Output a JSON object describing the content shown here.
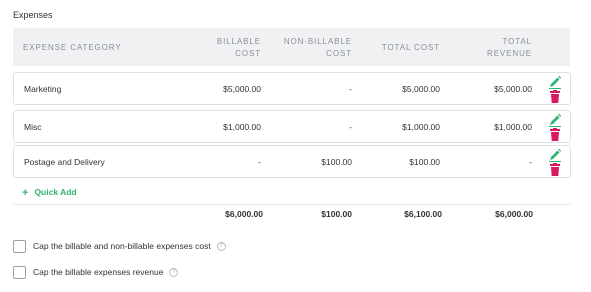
{
  "section_title": "Expenses",
  "columns": {
    "category": "EXPENSE CATEGORY",
    "billable_line1": "BILLABLE",
    "billable_line2": "COST",
    "nonbillable_line1": "NON-BILLABLE",
    "nonbillable_line2": "COST",
    "total_cost": "TOTAL COST",
    "total_revenue_line1": "TOTAL",
    "total_revenue_line2": "REVENUE"
  },
  "rows": [
    {
      "category": "Marketing",
      "billable": "$5,000.00",
      "nonbillable": "-",
      "total_cost": "$5,000.00",
      "total_revenue": "$5,000.00"
    },
    {
      "category": "Misc",
      "billable": "$1,000.00",
      "nonbillable": "-",
      "total_cost": "$1,000.00",
      "total_revenue": "$1,000.00"
    },
    {
      "category": "Postage and Delivery",
      "billable": "-",
      "nonbillable": "$100.00",
      "total_cost": "$100.00",
      "total_revenue": "-"
    }
  ],
  "icons": {
    "edit": "pencil-icon",
    "delete": "trash-icon",
    "help": "help-circle-icon",
    "add": "plus-icon"
  },
  "colors": {
    "edit": "#2bb673",
    "delete": "#d81b60",
    "accent": "#2bb673"
  },
  "quick_add": {
    "icon": "+",
    "label": "Quick Add"
  },
  "totals": {
    "billable": "$6,000.00",
    "nonbillable": "$100.00",
    "total_cost": "$6,100.00",
    "total_revenue": "$6,000.00"
  },
  "options": [
    {
      "label": "Cap the billable and non-billable expenses cost",
      "help": "?",
      "checked": false
    },
    {
      "label": "Cap the billable expenses revenue",
      "help": "?",
      "checked": false
    }
  ]
}
